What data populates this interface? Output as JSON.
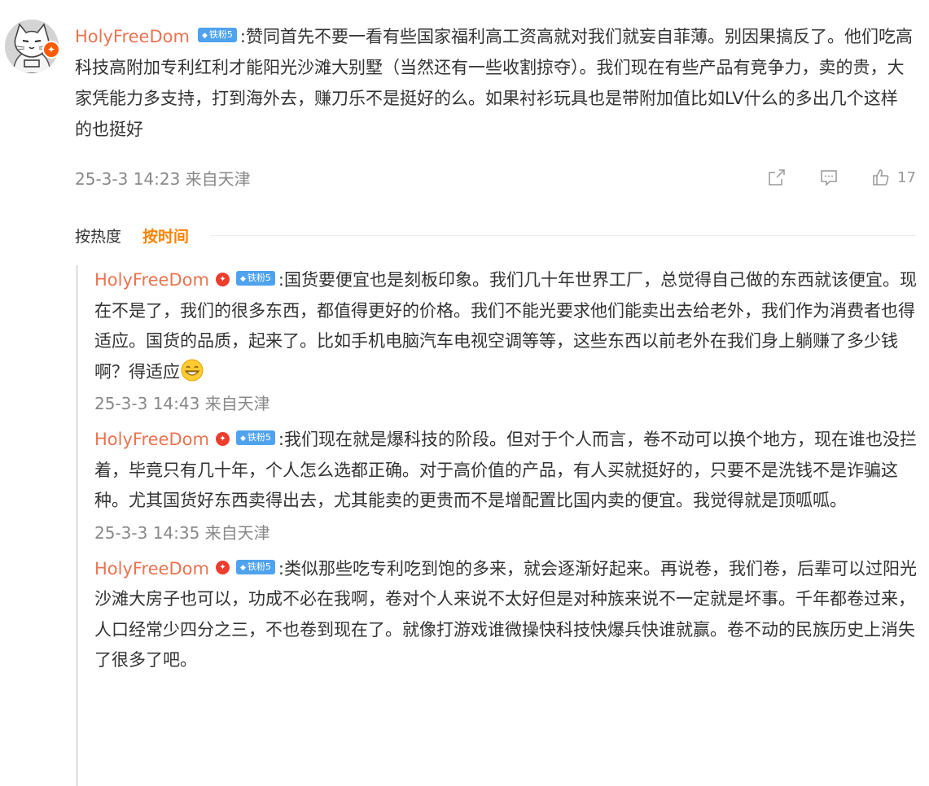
{
  "comment": {
    "username": "HolyFreeDom",
    "fan_badge": "铁粉5",
    "text": ":赞同首先不要一看有些国家福利高工资高就对我们就妄自菲薄。别因果搞反了。他们吃高科技高附加专利红利才能阳光沙滩大别墅（当然还有一些收割掠夺）。我们现在有些产品有竞争力，卖的贵，大家凭能力多支持，打到海外去，赚刀乐不是挺好的么。如果衬衫玩具也是带附加值比如LV什么的多出几个这样的也挺好",
    "timestamp": "25-3-3 14:23 来自天津",
    "like_count": "17"
  },
  "sort": {
    "by_heat": "按热度",
    "by_time": "按时间"
  },
  "replies": [
    {
      "username": "HolyFreeDom",
      "fan_badge": "铁粉5",
      "text": ":国货要便宜也是刻板印象。我们几十年世界工厂，总觉得自己做的东西就该便宜。现在不是了，我们的很多东西，都值得更好的价格。我们不能光要求他们能卖出去给老外，我们作为消费者也得适应。国货的品质，起来了。比如手机电脑汽车电视空调等等，这些东西以前老外在我们身上躺赚了多少钱啊？得适应",
      "timestamp": "25-3-3 14:43 来自天津"
    },
    {
      "username": "HolyFreeDom",
      "fan_badge": "铁粉5",
      "text": ":我们现在就是爆科技的阶段。但对于个人而言，卷不动可以换个地方，现在谁也没拦着，毕竟只有几十年，个人怎么选都正确。对于高价值的产品，有人买就挺好的，只要不是洗钱不是诈骗这种。尤其国货好东西卖得出去，尤其能卖的更贵而不是增配置比国内卖的便宜。我觉得就是顶呱呱。",
      "timestamp": "25-3-3 14:35 来自天津"
    },
    {
      "username": "HolyFreeDom",
      "fan_badge": "铁粉5",
      "text": ":类似那些吃专利吃到饱的多来，就会逐渐好起来。再说卷，我们卷，后辈可以过阳光沙滩大房子也可以，功成不必在我啊，卷对个人来说不太好但是对种族来说不一定就是坏事。千年都卷过来，人口经常少四分之三，不也卷到现在了。就像打游戏谁微操快科技快爆兵快谁就赢。卷不动的民族历史上消失了很多了吧。"
    }
  ],
  "icons": {
    "share": "share-icon",
    "comment": "comment-icon",
    "like": "thumbs-up-icon",
    "verified": "verified-badge-icon",
    "emoji": "grin-emoji-icon"
  },
  "colors": {
    "username": "#eb7350",
    "active_sort": "#ff8200",
    "fan_badge": "#4fa3ee",
    "verified": "#ef3d2d"
  }
}
